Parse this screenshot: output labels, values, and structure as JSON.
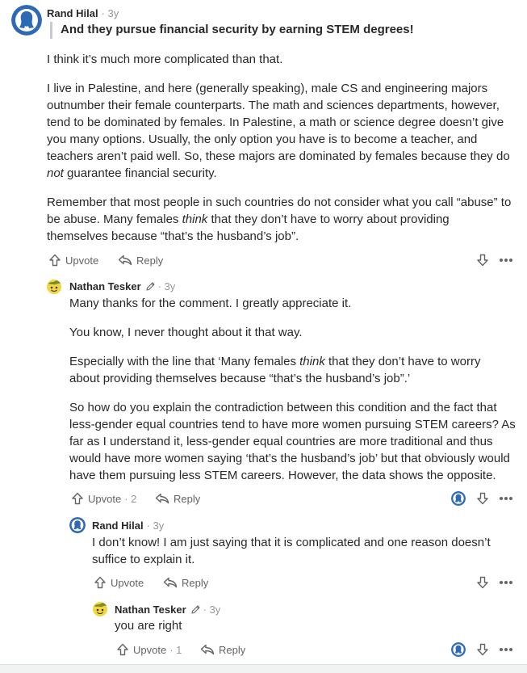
{
  "thread": [
    {
      "author": "Rand Hilal",
      "time": "· 3y",
      "quote": "And they pursue financial security by earning STEM degrees!",
      "p1": "I think it’s much more complicated than that.",
      "p2": [
        "I live in Palestine, and here (generally speaking), male CS and engineering majors",
        "outnumber their female counterparts. The math and sciences departments, however,",
        "tend to be dominated by females. In Palestine, a math or science degree doesn’t give",
        "you many options. Usually, the only option you have is to become a teacher, and",
        "teachers aren’t paid well. So, these majors are dominated by females because they do",
        "guarantee financial security."
      ],
      "p2_em": "not",
      "p3": [
        "Remember that most people in such countries do not consider what you call “abuse” to",
        "be abuse. Many females",
        "that they don’t have to worry about providing",
        "themselves because “that’s the husband’s job”."
      ],
      "p3_em": "think",
      "upvote_label": "Upvote",
      "reply_label": "Reply"
    },
    {
      "author": "Nathan Tesker",
      "time": "· 3y",
      "p1": "Many thanks for the comment. I greatly appreciate it.",
      "p2": "You know, I never thought about it that way.",
      "p3": [
        "Especially with the line that ‘Many females",
        "that they don’t have to worry",
        "about providing themselves because “that’s the husband’s job”.’"
      ],
      "p3_em": "think",
      "p4": [
        "So how do you explain the contradiction between this condition and the fact that",
        "less-gender equal countries tend to have more women pursuing STEM careers? As",
        "far as I understand it, less-gender equal countries are more traditional and thus",
        "would have more women saying ‘that’s the husband’s job’ but that obviously would",
        "have them pursuing less STEM careers. However, the data shows the opposite."
      ],
      "upvote_label": "Upvote",
      "upvote_count": "· 2",
      "reply_label": "Reply"
    },
    {
      "author": "Rand Hilal",
      "time": "· 3y",
      "p1": [
        "I don’t know! I am just saying that it is complicated and one reason doesn’t",
        "suffice to explain it."
      ],
      "upvote_label": "Upvote",
      "reply_label": "Reply"
    },
    {
      "author": "Nathan Tesker",
      "time": "· 3y",
      "p1": "you are right",
      "upvote_label": "Upvote",
      "upvote_count": "· 1",
      "reply_label": "Reply"
    }
  ],
  "icons": {
    "upvote": "upvote-arrow-icon",
    "reply": "reply-arrow-icon",
    "downvote": "downvote-arrow-icon",
    "more": "more-dots-icon",
    "edit": "pencil-icon",
    "upvoter": "upvoter-avatar-icon"
  },
  "colors": {
    "text": "#282829",
    "meta": "#939598",
    "action": "#636466",
    "avatar_blue": "#2e69b3",
    "quote_border": "#c9cacb"
  }
}
